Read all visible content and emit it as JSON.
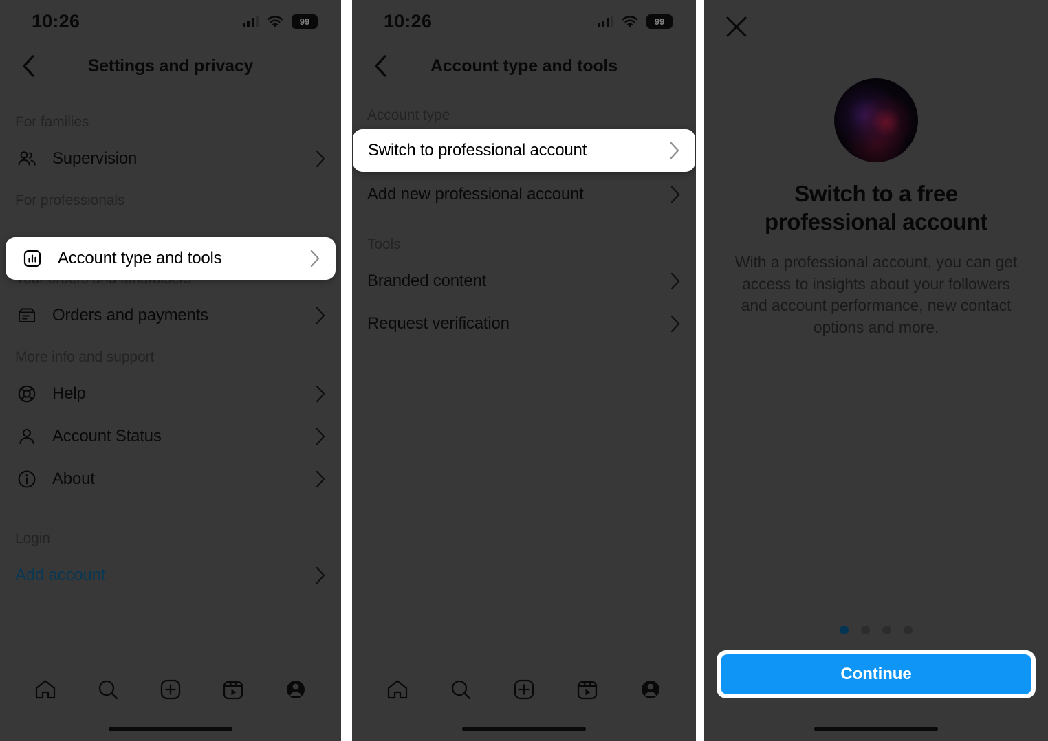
{
  "statusbar": {
    "time": "10:26",
    "battery": "99",
    "signal_icon": "cellular-signal-icon",
    "wifi_icon": "wifi-icon",
    "battery_icon": "battery-icon"
  },
  "colors": {
    "accent_blue": "#0e95f5",
    "link_blue": "#0e5f91",
    "dot_active": "#0a5c93",
    "panel_bg": "#616161",
    "highlight_bg": "#ffffff"
  },
  "panel1": {
    "title": "Settings and privacy",
    "back_icon": "chevron-left-icon",
    "sections": [
      {
        "label": "For families",
        "items": [
          {
            "label": "Supervision",
            "icon": "people-icon",
            "highlight": false,
            "link": false
          }
        ]
      },
      {
        "label": "For professionals",
        "items": [
          {
            "label": "Account type and tools",
            "icon": "bar-chart-box-icon",
            "highlight": true,
            "link": false
          }
        ]
      },
      {
        "label": "Your orders and fundraisers",
        "items": [
          {
            "label": "Orders and payments",
            "icon": "receipt-box-icon",
            "highlight": false,
            "link": false
          }
        ]
      },
      {
        "label": "More info and support",
        "items": [
          {
            "label": "Help",
            "icon": "lifebuoy-icon",
            "highlight": false,
            "link": false
          },
          {
            "label": "Account Status",
            "icon": "person-icon",
            "highlight": false,
            "link": false
          },
          {
            "label": "About",
            "icon": "info-circle-icon",
            "highlight": false,
            "link": false
          }
        ]
      },
      {
        "label": "Login",
        "items": [
          {
            "label": "Add account",
            "icon": "none",
            "highlight": false,
            "link": true
          }
        ]
      }
    ],
    "highlighted_item": {
      "label": "Account type and tools",
      "icon": "bar-chart-box-icon"
    }
  },
  "panel2": {
    "title": "Account type and tools",
    "back_icon": "chevron-left-icon",
    "sections": [
      {
        "label": "Account type",
        "items": [
          {
            "label": "Switch to professional account",
            "highlight": true
          },
          {
            "label": "Add new professional account",
            "highlight": false
          }
        ]
      },
      {
        "label": "Tools",
        "items": [
          {
            "label": "Branded content",
            "highlight": false
          },
          {
            "label": "Request verification",
            "highlight": false
          }
        ]
      }
    ],
    "highlighted_item": {
      "label": "Switch to professional account"
    }
  },
  "panel3": {
    "close_icon": "close-icon",
    "avatar_alt": "profile-avatar",
    "title": "Switch to a free professional account",
    "body": "With a professional account, you can get access to insights about your followers and account performance, new contact options and more.",
    "pager": {
      "total": 4,
      "active_index": 0
    },
    "cta_label": "Continue"
  },
  "tabbar": {
    "items": [
      {
        "name": "home-icon",
        "label": "Home"
      },
      {
        "name": "search-icon",
        "label": "Search"
      },
      {
        "name": "create-icon",
        "label": "Create"
      },
      {
        "name": "reels-icon",
        "label": "Reels"
      },
      {
        "name": "profile-icon",
        "label": "Profile"
      }
    ]
  }
}
